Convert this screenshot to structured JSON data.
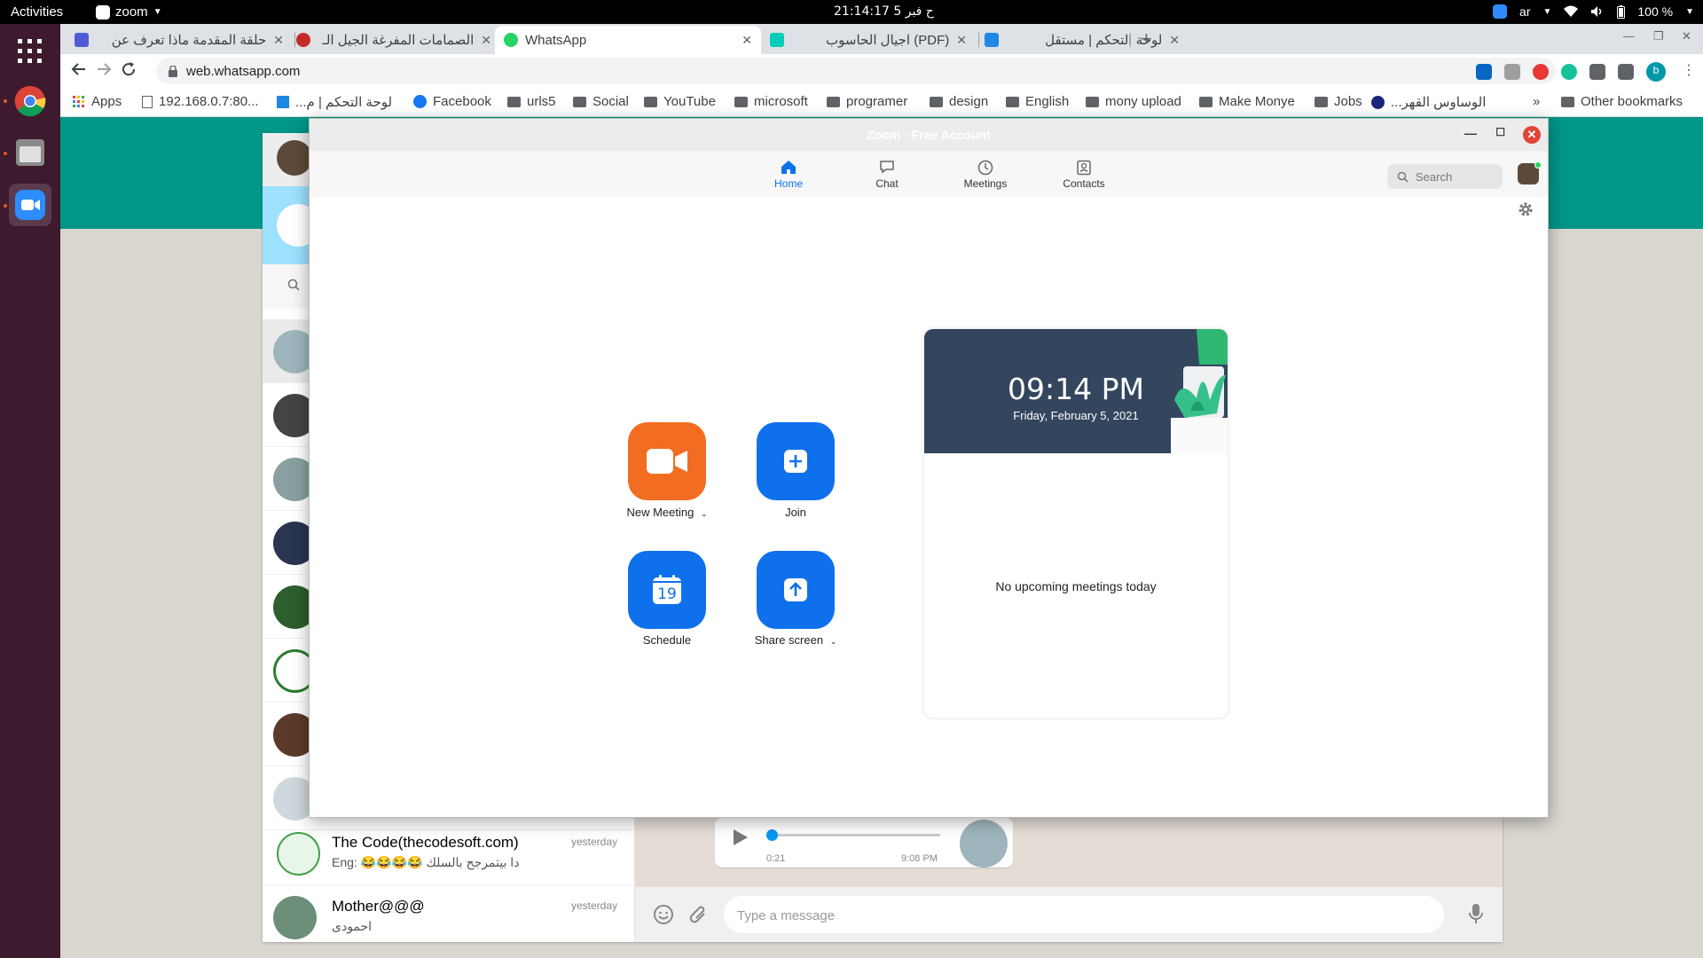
{
  "topbar": {
    "activities": "Activities",
    "app_name": "zoom",
    "clock": "ح فبر 5  21:14:17",
    "lang": "ar",
    "battery": "100 %"
  },
  "dock": {
    "items": [
      "apps-grid-icon",
      "chrome-icon",
      "files-icon",
      "zoom-icon"
    ]
  },
  "browser": {
    "tabs": [
      {
        "title": "حلقة المقدمة ماذا تعرف عن",
        "favicon": "docs-icon",
        "color": "#4f5bd5"
      },
      {
        "title": "الصمامات المفرغة الجيل الـ",
        "favicon": "red-circle-icon",
        "color": "#c62828"
      },
      {
        "title": "WhatsApp",
        "favicon": "whatsapp-icon",
        "color": "#25d366"
      },
      {
        "title": "(PDF) اجيال الحاسوب",
        "favicon": "researchgate-icon",
        "color": "#00ccbb"
      },
      {
        "title": "لوحة التحكم | مستقل",
        "favicon": "mostaql-icon",
        "color": "#1e88e5"
      }
    ],
    "url": "web.whatsapp.com",
    "bookmarks": [
      {
        "label": "Apps",
        "icon": "apps-icon"
      },
      {
        "label": "192.168.0.7:80...",
        "icon": "page-icon"
      },
      {
        "label": "لوحة التحكم | م...",
        "icon": "mostaql-icon"
      },
      {
        "label": "Facebook",
        "icon": "facebook-icon"
      },
      {
        "label": "urls5",
        "icon": "folder-icon"
      },
      {
        "label": "Social",
        "icon": "folder-icon"
      },
      {
        "label": "YouTube",
        "icon": "folder-icon"
      },
      {
        "label": "microsoft",
        "icon": "folder-icon"
      },
      {
        "label": "programer",
        "icon": "folder-icon"
      },
      {
        "label": "design",
        "icon": "folder-icon"
      },
      {
        "label": "English",
        "icon": "folder-icon"
      },
      {
        "label": "mony upload",
        "icon": "folder-icon"
      },
      {
        "label": "Make Monye",
        "icon": "folder-icon"
      },
      {
        "label": "Jobs",
        "icon": "folder-icon"
      },
      {
        "label": "الوساوس القهر...",
        "icon": "site-icon"
      }
    ],
    "more_bookmarks": "»",
    "other_bookmarks": "Other bookmarks",
    "profile_initial": "b"
  },
  "whatsapp": {
    "chats": [
      {
        "name": "The Code(thecodesoft.com)",
        "time": "yesterday",
        "preview": "دا بيتمرجح بالسلك 😂😂😂😂 :Eng"
      },
      {
        "name": "Mother@@@",
        "time": "yesterday",
        "preview": "احمودى"
      }
    ],
    "voice": {
      "duration": "0:21",
      "time": "9:08 PM"
    },
    "input_placeholder": "Type a message"
  },
  "zoom": {
    "title": "Zoom - Free Account",
    "nav": [
      {
        "label": "Home",
        "icon": "home-icon"
      },
      {
        "label": "Chat",
        "icon": "chat-icon"
      },
      {
        "label": "Meetings",
        "icon": "clock-icon"
      },
      {
        "label": "Contacts",
        "icon": "contacts-icon"
      }
    ],
    "search_placeholder": "Search",
    "actions": {
      "new_meeting": "New Meeting",
      "join": "Join",
      "schedule": "Schedule",
      "schedule_day": "19",
      "share_screen": "Share screen"
    },
    "colors": {
      "orange": "#f26d21",
      "blue": "#0e71eb"
    },
    "card": {
      "time": "09:14 PM",
      "date": "Friday, February 5, 2021",
      "empty": "No upcoming meetings today"
    }
  }
}
